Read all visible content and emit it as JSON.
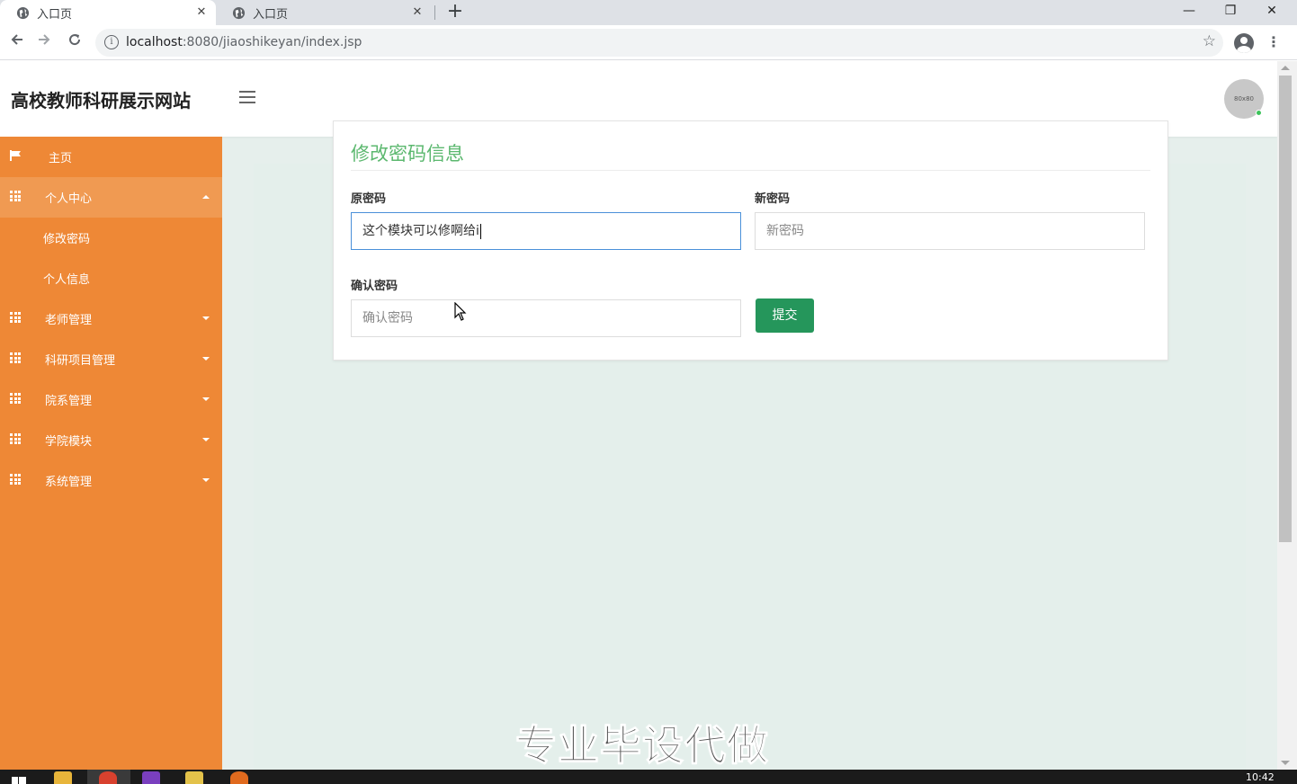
{
  "browser": {
    "tabs": [
      {
        "title": "入口页",
        "active": true
      },
      {
        "title": "入口页",
        "active": false
      }
    ],
    "new_tab": "+",
    "window_controls": {
      "minimize": "—",
      "restore": "❐",
      "close": "✕"
    },
    "url_host": "localhost",
    "url_rest": ":8080/jiaoshikeyan/index.jsp"
  },
  "header": {
    "site_title": "高校教师科研展示网站",
    "avatar_text": "80x80"
  },
  "sidebar": {
    "items": [
      {
        "label": "主页",
        "icon": "flag-icon"
      },
      {
        "label": "个人中心",
        "icon": "grid-icon",
        "expanded": true
      },
      {
        "label": "修改密码",
        "sub": true
      },
      {
        "label": "个人信息",
        "sub": true
      },
      {
        "label": "老师管理",
        "icon": "grid-icon"
      },
      {
        "label": "科研项目管理",
        "icon": "grid-icon"
      },
      {
        "label": "院系管理",
        "icon": "grid-icon"
      },
      {
        "label": "学院模块",
        "icon": "grid-icon"
      },
      {
        "label": "系统管理",
        "icon": "grid-icon"
      }
    ]
  },
  "form": {
    "title": "修改密码信息",
    "old_password": {
      "label": "原密码",
      "value": "这个模块可以修啊给i"
    },
    "new_password": {
      "label": "新密码",
      "placeholder": "新密码"
    },
    "confirm_password": {
      "label": "确认密码",
      "placeholder": "确认密码"
    },
    "submit_label": "提交"
  },
  "overlay": {
    "watermark": "专业毕设代做"
  },
  "taskbar": {
    "clock": "10:42"
  },
  "colors": {
    "sidebar_bg": "#ee8836",
    "title_green": "#5cb86f",
    "submit_green": "#25965b",
    "content_bg": "#e6efec"
  }
}
